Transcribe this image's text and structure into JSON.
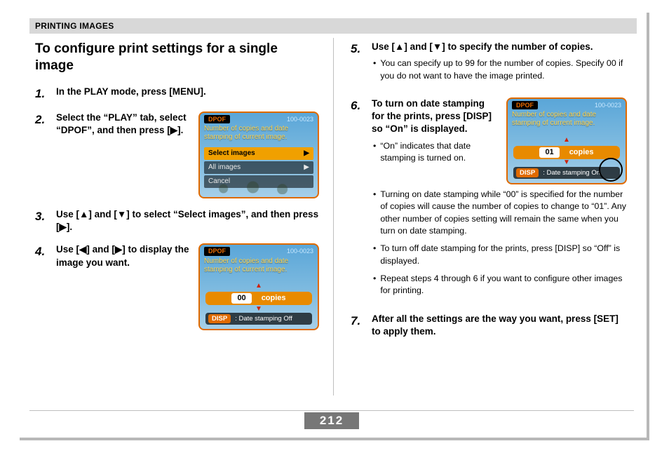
{
  "header": "PRINTING IMAGES",
  "page_number": "212",
  "section_title": "To configure print settings for a single image",
  "steps": {
    "s1": {
      "num": "1.",
      "head": "In the PLAY mode, press [MENU]."
    },
    "s2": {
      "num": "2.",
      "head": "Select the “PLAY” tab, select “DPOF”, and then press [▶]."
    },
    "s3": {
      "num": "3.",
      "head": "Use [▲] and [▼] to select “Select images”, and then press [▶]."
    },
    "s4": {
      "num": "4.",
      "head": "Use [◀] and [▶] to display the image you want."
    },
    "s5": {
      "num": "5.",
      "head": "Use [▲] and [▼] to specify the number of copies.",
      "b1": "You can specify up to 99 for the number of copies. Specify 00 if you do not want to have the image printed."
    },
    "s6": {
      "num": "6.",
      "head": "To turn on date stamping for the prints, press [DISP] so “On” is displayed.",
      "b1": "“On” indicates that date stamping is turned on.",
      "b2": "Turning on date stamping while “00” is specified for the number of copies will cause the number of copies to change to “01”. Any other number of copies setting will remain the same when you turn on date stamping.",
      "b3": "To turn off date stamping for the prints, press [DISP] so “Off” is displayed.",
      "b4": "Repeat steps 4 through 6 if you want to configure other images for printing."
    },
    "s7": {
      "num": "7.",
      "head": "After all the settings are the way you want, press [SET] to apply them."
    }
  },
  "lcdA": {
    "dpof": "DPOF",
    "counter": "100-0023",
    "subtitle": "Number of copies and date stamping of current image.",
    "row1": "Select images",
    "row2": "All images",
    "row3": "Cancel",
    "arrow": "▶"
  },
  "lcdB": {
    "dpof": "DPOF",
    "counter": "100-0023",
    "subtitle": "Number of copies and date stamping of current image.",
    "up": "▲",
    "down": "▼",
    "copies_num": "00",
    "copies_label": "copies",
    "disp": "DISP",
    "disp_text": ": Date stamping Off"
  },
  "lcdC": {
    "dpof": "DPOF",
    "counter": "100-0023",
    "subtitle": "Number of copies and date stamping of current image.",
    "up": "▲",
    "down": "▼",
    "copies_num": "01",
    "copies_label": "copies",
    "disp": "DISP",
    "disp_text": ": Date stamping On"
  }
}
